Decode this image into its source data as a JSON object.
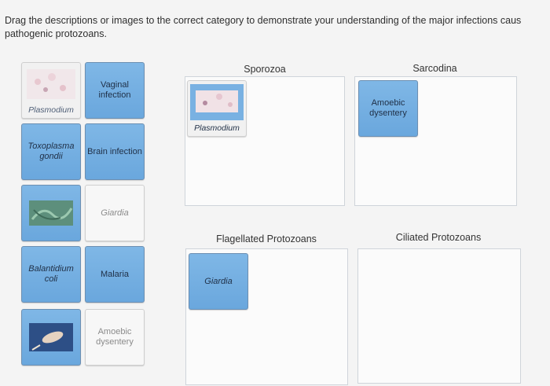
{
  "instructions": {
    "line1": "Drag the descriptions or images to the correct category to demonstrate your understanding of the major infections caus",
    "line2": "pathogenic protozoans."
  },
  "bank": {
    "plasmodium_label": "Plasmodium",
    "vaginal_infection": "Vaginal infection",
    "toxoplasma": "Toxoplasma gondii",
    "brain_infection": "Brain infection",
    "giardia_ghost": "Giardia",
    "balantidium": "Balantidium coli",
    "malaria": "Malaria",
    "amoebic_ghost": "Amoebic dysentery"
  },
  "categories": {
    "sporozoa": {
      "title": "Sporozoa",
      "placed_label": "Plasmodium"
    },
    "sarcodina": {
      "title": "Sarcodina",
      "placed_label": "Amoebic dysentery"
    },
    "flagellated": {
      "title": "Flagellated Protozoans",
      "placed_label": "Giardia"
    },
    "ciliated": {
      "title": "Ciliated Protozoans"
    }
  },
  "colors": {
    "card_fill": "#79b1e2",
    "card_border": "#6c8fb2",
    "zone_border": "#cfd4da"
  }
}
